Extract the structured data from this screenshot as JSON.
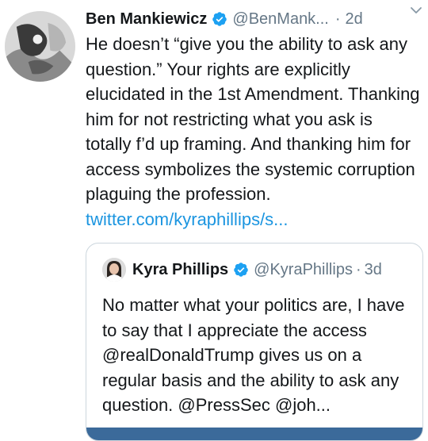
{
  "tweet": {
    "author_name": "Ben Mankiewicz",
    "handle": "@BenMank...",
    "separator": "·",
    "time": "2d",
    "text_part1": "He doesn’t “give you the ability to ask any question.” Your rights are explicitly elucidated in the 1st Amendment. Thanking him for not restricting what you ask is totally f’d up framing. And thanking him for access symbolizes the systemic corruption plaguing the profession. ",
    "link": "twitter.com/kyraphillips/s...",
    "verified_icon": "verified-badge-icon",
    "menu_icon": "chevron-down-icon",
    "colors": {
      "link": "#1b95e0",
      "verified": "#1da1f2",
      "muted": "#657786",
      "text": "#14171a"
    }
  },
  "quoted": {
    "author_name": "Kyra Phillips",
    "handle": "@KyraPhillips",
    "separator": "·",
    "time": "3d",
    "text": "No matter what your politics are, I have to say that I appreciate the access @realDonaldTrump gives us on a regular basis and the ability to ask any question. @PressSec @joh...",
    "verified_icon": "verified-badge-icon"
  }
}
